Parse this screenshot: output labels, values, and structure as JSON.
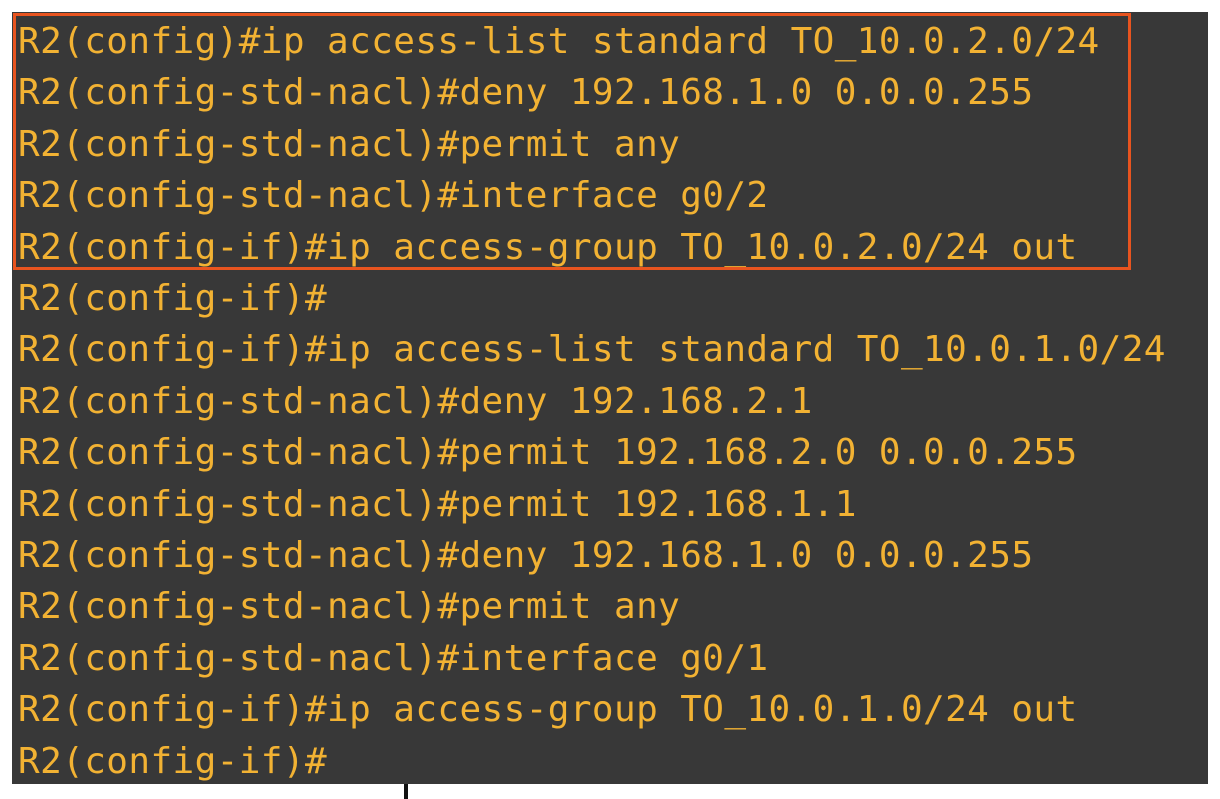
{
  "colors": {
    "background": "#383838",
    "text": "#f2b233",
    "highlight_border": "#e8541f",
    "page": "#ffffff"
  },
  "terminal": {
    "highlighted_lines": [
      0,
      1,
      2,
      3,
      4
    ],
    "lines": [
      "R2(config)#ip access-list standard TO_10.0.2.0/24",
      "R2(config-std-nacl)#deny 192.168.1.0 0.0.0.255",
      "R2(config-std-nacl)#permit any",
      "R2(config-std-nacl)#interface g0/2",
      "R2(config-if)#ip access-group TO_10.0.2.0/24 out",
      "R2(config-if)#",
      "R2(config-if)#ip access-list standard TO_10.0.1.0/24",
      "R2(config-std-nacl)#deny 192.168.2.1",
      "R2(config-std-nacl)#permit 192.168.2.0 0.0.0.255",
      "R2(config-std-nacl)#permit 192.168.1.1",
      "R2(config-std-nacl)#deny 192.168.1.0 0.0.0.255",
      "R2(config-std-nacl)#permit any",
      "R2(config-std-nacl)#interface g0/1",
      "R2(config-if)#ip access-group TO_10.0.1.0/24 out",
      "R2(config-if)#"
    ]
  }
}
